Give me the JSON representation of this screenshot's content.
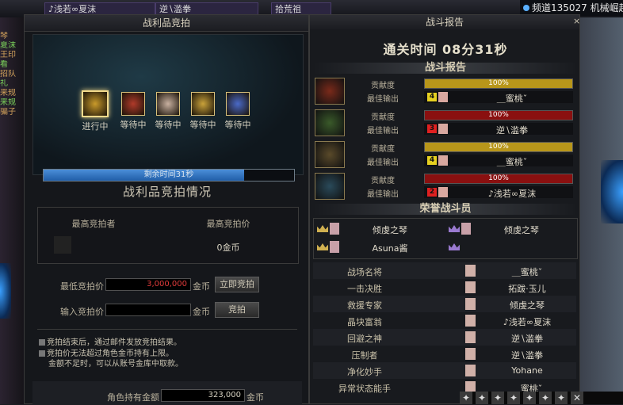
{
  "top": {
    "chips": [
      "♪浅若∞夏沫",
      "逆∖滥拳",
      "拾荒祖"
    ],
    "channel": "频道135027 机械崛起"
  },
  "left_chat": [
    "琴",
    "夏沫",
    "王印",
    "看",
    "招队",
    "礼",
    "来规",
    "来规",
    "骗子"
  ],
  "auction": {
    "title": "战利品竞拍",
    "help": "?",
    "items": [
      {
        "label": "进行中",
        "state": "active",
        "color": "#c99a2a"
      },
      {
        "label": "等待中",
        "state": "waiting",
        "color": "#b03a2a"
      },
      {
        "label": "等待中",
        "state": "waiting",
        "color": "#c8b0a0"
      },
      {
        "label": "等待中",
        "state": "waiting",
        "color": "#c9a23a"
      },
      {
        "label": "等待中",
        "state": "waiting",
        "color": "#4a6ac8"
      }
    ],
    "time_text": "剩余时间31秒",
    "time_progress": 0.8,
    "section_title": "战利品竞拍情况",
    "top_bidder_header": "最高竞拍者",
    "top_price_header": "最高竞拍价",
    "current_price": "0金币",
    "min_bid_label": "最低竞拍价",
    "min_bid_value": "3,000,000",
    "unit": "金币",
    "instant_bid_button": "立即竞拍",
    "input_bid_label": "输入竞拍价",
    "input_bid_value": "",
    "bid_button": "竞拍",
    "notes": [
      "竞拍结束后，通过邮件发放竞拍结果。",
      "竞拍价无法超过角色金币持有上限。",
      "金额不足时，可以从账号金库中取款。"
    ],
    "gold_label": "角色持有金额",
    "gold_value": "323,000",
    "gold_unit": "金币"
  },
  "report": {
    "title": "战斗报告",
    "close": "×",
    "clear_time": "通关时间   08分31秒",
    "section1": "战斗报告",
    "contribution_label": "贡献度",
    "best_output_label": "最佳输出",
    "players": [
      {
        "percent": "100%",
        "progress": 1.0,
        "bar_color": "#b8961a",
        "rank": "4",
        "rank_color": "#e6d020",
        "name": "＿蜜桃ˇ",
        "portrait": "#7a2a1a"
      },
      {
        "percent": "100%",
        "progress": 1.0,
        "bar_color": "#8a1010",
        "rank": "3",
        "rank_color": "#e02020",
        "name": "逆∖滥拳",
        "portrait": "#3a5a2a"
      },
      {
        "percent": "100%",
        "progress": 1.0,
        "bar_color": "#b8961a",
        "rank": "4",
        "rank_color": "#e6d020",
        "name": "＿蜜桃ˇ",
        "portrait": "#5a4a2a"
      },
      {
        "percent": "100%",
        "progress": 1.0,
        "bar_color": "#8a1010",
        "rank": "2",
        "rank_color": "#e02020",
        "name": "♪浅若∞夏沫",
        "portrait": "#2a4a5a"
      }
    ],
    "section2": "荣誉战斗员",
    "honors": [
      "倾虔之琴",
      "倾虔之琴",
      "Asuna酱",
      ""
    ],
    "titles": [
      {
        "title": "战场名将",
        "player": "＿蜜桃ˇ"
      },
      {
        "title": "一击决胜",
        "player": "拓跋·玉儿"
      },
      {
        "title": "救援专家",
        "player": "倾虔之琴"
      },
      {
        "title": "晶块富翁",
        "player": "♪浅若∞夏沫"
      },
      {
        "title": "回避之神",
        "player": "逆∖滥拳"
      },
      {
        "title": "压制者",
        "player": "逆∖滥拳"
      },
      {
        "title": "净化妙手",
        "player": "Yohane"
      },
      {
        "title": "异常状态能手",
        "player": "＿蜜桃ˇ"
      }
    ]
  },
  "hotbar": [
    "✦",
    "✦",
    "✦",
    "✦",
    "✦",
    "✦",
    "✦",
    "✕"
  ]
}
